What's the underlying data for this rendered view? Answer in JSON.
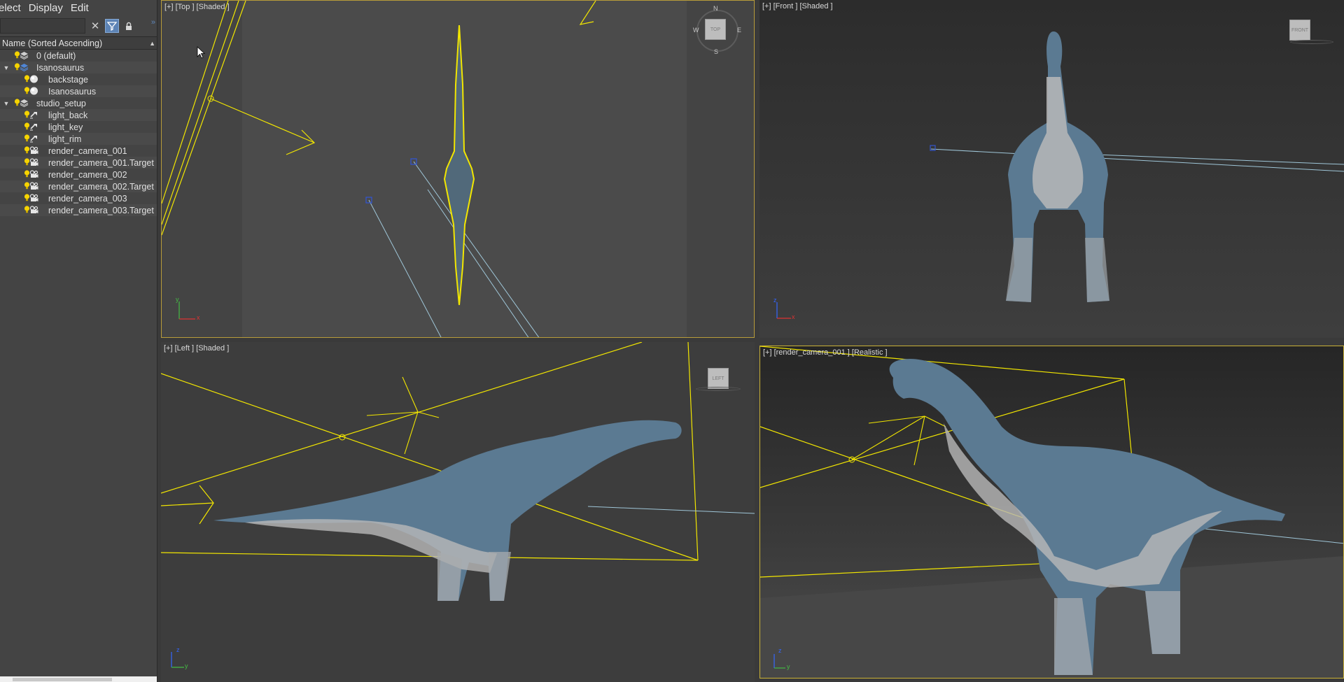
{
  "menu": {
    "items": [
      "elect",
      "Display",
      "Edit"
    ]
  },
  "toolbar": {
    "search_value": "",
    "clear_glyph": "✕",
    "filter_glyph": "⊻",
    "lock_glyph": "🔒",
    "expand_glyph": "»"
  },
  "column_header": {
    "label": "Name (Sorted Ascending)",
    "sort_glyph": "▲"
  },
  "tree": [
    {
      "label": "0 (default)",
      "depth": 1,
      "icon": "layer-icon",
      "expander": ""
    },
    {
      "label": "Isanosaurus",
      "depth": 1,
      "icon": "layer-active-icon",
      "expander": "▼"
    },
    {
      "label": "backstage",
      "depth": 2,
      "icon": "geometry-sphere-icon",
      "expander": ""
    },
    {
      "label": "Isanosaurus",
      "depth": 2,
      "icon": "geometry-sphere-icon",
      "expander": ""
    },
    {
      "label": "studio_setup",
      "depth": 1,
      "icon": "layer-icon",
      "expander": "▼"
    },
    {
      "label": "light_back",
      "depth": 2,
      "icon": "light-icon",
      "expander": ""
    },
    {
      "label": "light_key",
      "depth": 2,
      "icon": "light-icon",
      "expander": ""
    },
    {
      "label": "light_rim",
      "depth": 2,
      "icon": "light-icon",
      "expander": ""
    },
    {
      "label": "render_camera_001",
      "depth": 2,
      "icon": "camera-icon",
      "expander": ""
    },
    {
      "label": "render_camera_001.Target",
      "depth": 2,
      "icon": "camera-icon",
      "expander": ""
    },
    {
      "label": "render_camera_002",
      "depth": 2,
      "icon": "camera-icon",
      "expander": ""
    },
    {
      "label": "render_camera_002.Target",
      "depth": 2,
      "icon": "camera-icon",
      "expander": ""
    },
    {
      "label": "render_camera_003",
      "depth": 2,
      "icon": "camera-icon",
      "expander": ""
    },
    {
      "label": "render_camera_003.Target",
      "depth": 2,
      "icon": "camera-icon",
      "expander": ""
    }
  ],
  "viewports": {
    "top": {
      "label": "[+] [Top ] [Shaded ]",
      "compass": {
        "n": "N",
        "s": "S",
        "e": "E",
        "w": "W",
        "cube": "TOP"
      }
    },
    "front": {
      "label": "[+] [Front ] [Shaded ]",
      "cube": "FRONT"
    },
    "left": {
      "label": "[+] [Left ] [Shaded ]",
      "cube": "LEFT"
    },
    "camera": {
      "label": "[+] [render_camera_001 ] [Realistic ]"
    }
  },
  "axes": {
    "x": "x",
    "y": "y",
    "z": "z"
  },
  "colors": {
    "selection": "#f2e600",
    "frame": "#b89c3a",
    "light_blue_line": "#9fc6d8",
    "dino_body": "#5b7a92",
    "dino_belly": "#b9b9b9"
  }
}
